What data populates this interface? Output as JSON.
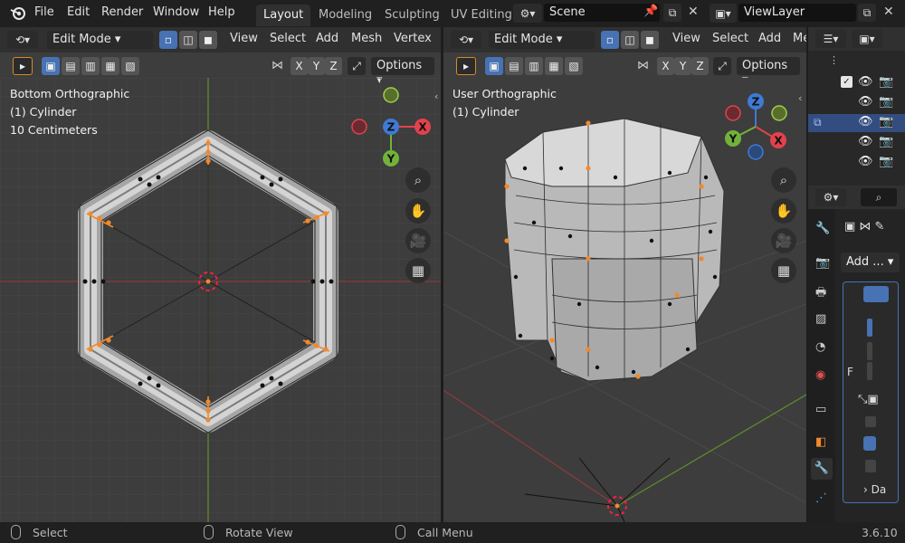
{
  "menubar": {
    "items": [
      "File",
      "Edit",
      "Render",
      "Window",
      "Help"
    ],
    "workspaces": [
      "Layout",
      "Modeling",
      "Sculpting",
      "UV Editing"
    ],
    "active_workspace": "Layout",
    "scene_name": "Scene",
    "view_layer": "ViewLayer"
  },
  "viewport_left": {
    "mode": "Edit Mode",
    "menus": [
      "View",
      "Select",
      "Add",
      "Mesh",
      "Vertex"
    ],
    "axes": [
      "X",
      "Y",
      "Z"
    ],
    "options_label": "Options",
    "overlay_lines": [
      "Bottom Orthographic",
      "(1) Cylinder",
      "10 Centimeters"
    ],
    "gizmo_axes": {
      "top": "",
      "left": "",
      "center": "Z",
      "right": "X",
      "bottom": "Y"
    }
  },
  "viewport_right": {
    "mode": "Edit Mode",
    "menus": [
      "View",
      "Select",
      "Add",
      "Me"
    ],
    "axes": [
      "X",
      "Y",
      "Z"
    ],
    "options_label": "Options",
    "overlay_lines": [
      "User Orthographic",
      "(1) Cylinder"
    ],
    "gizmo_axes": {
      "z": "Z",
      "y": "Y",
      "x": "X"
    }
  },
  "properties": {
    "add_label": "Add ...",
    "f_label": "F",
    "da_label": "Da"
  },
  "statusbar": {
    "select": "Select",
    "rotate": "Rotate View",
    "call_menu": "Call Menu",
    "version": "3.6.10"
  },
  "colors": {
    "accent_blue": "#4772b3",
    "axis_x": "#e2424d",
    "axis_y": "#72b23a",
    "axis_z": "#3e7ad6",
    "selected_vertex": "#f08a2c",
    "viewport_bg": "#3d3d3d"
  }
}
